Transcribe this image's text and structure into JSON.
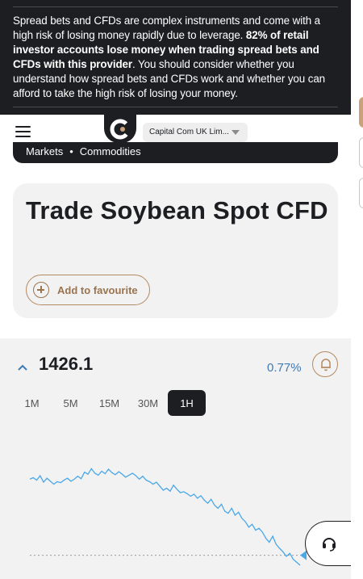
{
  "risk_warning": {
    "part1": "Spread bets and CFDs are complex instruments and come with a high risk of losing money rapidly due to leverage. ",
    "part2_bold": "82% of retail investor accounts lose money when trading spread bets and CFDs with this provider",
    "part3": ". You should consider whether you understand how spread bets and CFDs work and whether you can afford to take the high risk of losing your money."
  },
  "header": {
    "menu_icon": "hamburger-menu-icon",
    "logo_icon": "capital-com-logo",
    "entity_select": "Capital Com UK Lim..."
  },
  "breadcrumb": {
    "items": [
      "Markets",
      "Commodities"
    ],
    "separator": "•"
  },
  "instrument": {
    "title": "Trade Soybean Spot CFD",
    "favourite_label": "Add to favourite",
    "price": "1426.1",
    "change": "0.77%",
    "trend_icon": "chevron-up-icon",
    "alert_icon": "bell-icon"
  },
  "timeframes": {
    "options": [
      "1M",
      "5M",
      "15M",
      "30M",
      "1H"
    ],
    "selected": "1H"
  },
  "chart_data": {
    "type": "line",
    "series": [
      {
        "values": [
          70,
          67,
          72,
          63,
          76,
          68,
          74,
          80,
          75,
          77,
          72,
          68,
          74,
          70,
          64,
          69,
          56,
          60,
          49,
          58,
          62,
          54,
          59,
          50,
          57,
          61,
          55,
          60,
          66,
          62,
          58,
          63,
          70,
          64,
          72,
          75,
          80,
          76,
          84,
          92,
          88,
          94,
          82,
          90,
          97,
          95,
          99,
          104,
          100,
          108,
          103,
          112,
          118,
          110,
          122,
          128,
          120,
          134,
          138,
          128,
          142,
          136,
          148,
          155,
          166,
          160,
          172,
          168,
          176,
          188,
          196,
          184,
          200,
          208,
          215,
          224,
          218,
          230,
          236,
          242
        ]
      }
    ],
    "current_line": 222
  },
  "colors": {
    "dark": "#1d1e22",
    "accent": "#b48a62",
    "line": "#4aa8e8",
    "change": "#3d7ab8"
  },
  "support_icon": "headset-icon"
}
